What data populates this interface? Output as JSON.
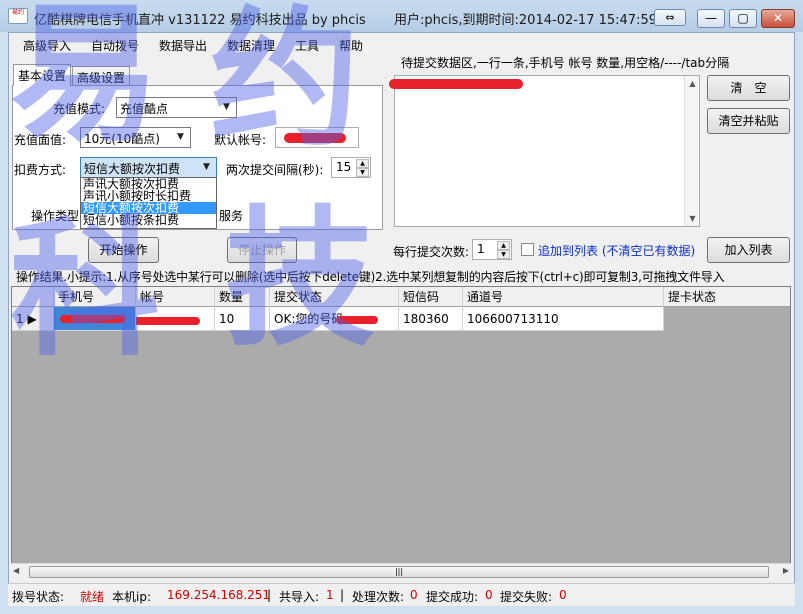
{
  "window": {
    "title": "亿酷棋牌电信手机直冲 v131122    易约科技出品  by phcis",
    "user_info": "用户:phcis,到期时间:2014-02-17 15:47:59",
    "switch_label": "⇔",
    "minimize_label": "—",
    "maximize_label": "▢",
    "close_label": "✕"
  },
  "menu": [
    "高级导入",
    "自动拨号",
    "数据导出",
    "数据清理",
    "工具",
    "帮助"
  ],
  "tabs": [
    "基本设置",
    "高级设置"
  ],
  "form": {
    "recharge_mode_label": "充值模式:",
    "recharge_mode_value": "充值酷点",
    "recharge_amount_label": "充值面值:",
    "recharge_amount_value": "10元(10酷点)",
    "default_account_label": "默认帐号:",
    "deduct_method_label": "扣费方式:",
    "deduct_method_value": "短信大额按次扣费",
    "interval_label": "两次提交间隔(秒):",
    "interval_value": "15",
    "op_type_label": "操作类型",
    "service_label": "服务",
    "deduct_options": [
      "声讯大额按次扣费",
      "声讯小额按时长扣费",
      "短信大额按次扣费",
      "短信小额按条扣费"
    ],
    "start_button": "开始操作",
    "stop_button": "停止操作"
  },
  "submit": {
    "area_label": "待提交数据区,一行一条,手机号 帐号 数量,用空格/----/tab分隔",
    "clear_button": "清　空",
    "clear_paste_button": "清空并粘贴",
    "per_row_label": "每行提交次数:",
    "per_row_value": "1",
    "append_label": "追加到列表 (不清空已有数据)",
    "add_list_button": "加入列表"
  },
  "hint": "操作结果.小提示:1.从序号处选中某行可以删除(选中后按下delete键)2.选中某列想复制的内容后按下(ctrl+c)即可复制3,可拖拽文件导入",
  "grid": {
    "columns": [
      "手机号",
      "帐号",
      "数量",
      "提交状态",
      "短信码",
      "通道号",
      "提卡状态"
    ],
    "rows": [
      {
        "index": "1",
        "phone": "",
        "account": "",
        "qty": "10",
        "status": "OK:您的号码",
        "sms_code": "180360",
        "channel": "106600713110",
        "card_status": ""
      }
    ]
  },
  "hscroll_label": "|||",
  "status": {
    "dial_label": "拨号状态:",
    "dial_value": "就绪",
    "ip_label": "本机ip:",
    "ip_value": "169.254.168.251",
    "imported_label": "共导入:",
    "imported_value": "1",
    "processed_label": "处理次数:",
    "processed_value": "0",
    "success_label": "提交成功:",
    "success_value": "0",
    "failed_label": "提交失败:",
    "failed_value": "0",
    "sep": "|"
  },
  "watermark": [
    "易",
    "约",
    "科",
    "技"
  ],
  "icon_text": "易约"
}
